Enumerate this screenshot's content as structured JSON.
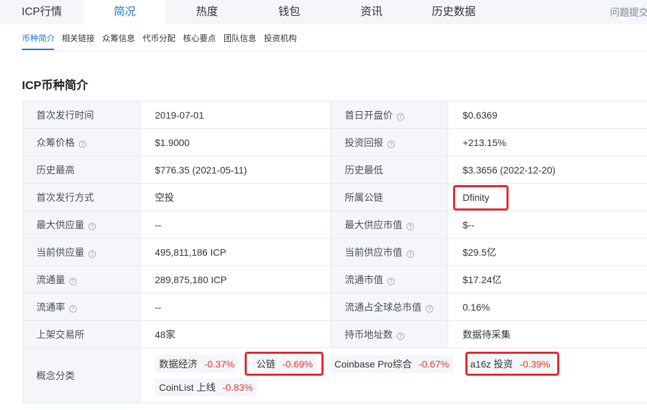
{
  "topnav": {
    "tabs": [
      {
        "label": "ICP行情"
      },
      {
        "label": "简况"
      },
      {
        "label": "热度"
      },
      {
        "label": "钱包"
      },
      {
        "label": "资讯"
      },
      {
        "label": "历史数据"
      }
    ],
    "active_tab": "简况",
    "report_label": "问题提交"
  },
  "subnav": {
    "items": [
      {
        "label": "币种简介"
      },
      {
        "label": "相关链接"
      },
      {
        "label": "众筹信息"
      },
      {
        "label": "代币分配"
      },
      {
        "label": "核心要点"
      },
      {
        "label": "团队信息"
      },
      {
        "label": "投资机构"
      }
    ],
    "active_item": "币种简介"
  },
  "section": {
    "title": "ICP币种简介"
  },
  "rows": [
    {
      "l1": "首次发行时间",
      "v1": "2019-07-01",
      "l2": "首日开盘价",
      "v2": "$0.6369"
    },
    {
      "l1": "众筹价格",
      "v1": "$1.9000",
      "l2": "投资回报",
      "v2": "+213.15%"
    },
    {
      "l1": "历史最高",
      "v1": "$776.35 (2021-05-11)",
      "l2": "历史最低",
      "v2": "$3.3656 (2022-12-20)"
    },
    {
      "l1": "首次发行方式",
      "v1": "空投",
      "l2": "所属公链",
      "v2": "Dfinity"
    },
    {
      "l1": "最大供应量",
      "v1": "--",
      "l2": "最大供应市值",
      "v2": "$--"
    },
    {
      "l1": "当前供应量",
      "v1": "495,811,186 ICP",
      "l2": "当前供应市值",
      "v2": "$29.5亿"
    },
    {
      "l1": "流通量",
      "v1": "289,875,180 ICP",
      "l2": "流通市值",
      "v2": "$17.24亿"
    },
    {
      "l1": "流通率",
      "v1": "--",
      "l2": "流通占全球总市值",
      "v2": "0.16%"
    },
    {
      "l1": "上架交易所",
      "v1": "48家",
      "l2": "持币地址数",
      "v2": "数据待采集"
    }
  ],
  "concept": {
    "label": "概念分类",
    "tags": [
      {
        "name": "数据经济",
        "change": "-0.37%"
      },
      {
        "name": "公链",
        "change": "-0.69%"
      },
      {
        "name": "Coinbase Pro综合",
        "change": "-0.67%"
      },
      {
        "name": "a16z 投资",
        "change": "-0.39%"
      },
      {
        "name": "CoinList 上线",
        "change": "-0.83%"
      }
    ]
  },
  "colors": {
    "accent": "#1677d2",
    "positive": "#1e9b4b",
    "negative": "#e8352d",
    "highlight_box": "#e22630"
  }
}
